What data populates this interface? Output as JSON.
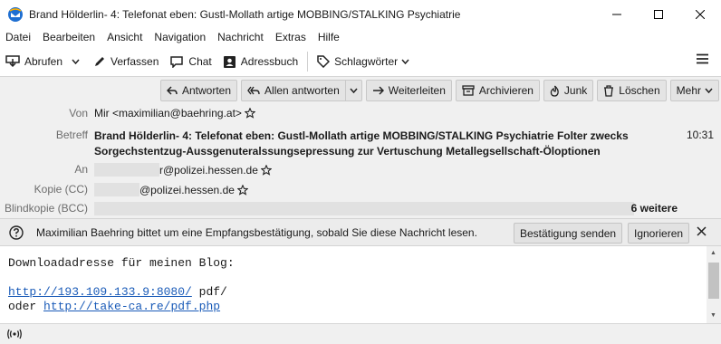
{
  "window": {
    "title": "Brand Hölderlin- 4: Telefonat eben: Gustl-Mollath artige MOBBING/STALKING Psychiatrie Folter zwecks Sorgechstentz..."
  },
  "menu": [
    "Datei",
    "Bearbeiten",
    "Ansicht",
    "Navigation",
    "Nachricht",
    "Extras",
    "Hilfe"
  ],
  "toolbar": {
    "get_messages": "Abrufen",
    "compose": "Verfassen",
    "chat": "Chat",
    "address_book": "Adressbuch",
    "tags": "Schlagwörter"
  },
  "actions": {
    "reply": "Antworten",
    "reply_all": "Allen antworten",
    "forward": "Weiterleiten",
    "archive": "Archivieren",
    "junk": "Junk",
    "delete": "Löschen",
    "more": "Mehr"
  },
  "headers": {
    "from_label": "Von",
    "from_value": "Mir <maximilian@baehring.at>",
    "subject_label": "Betreff",
    "subject_value": "Brand Hölderlin- 4: Telefonat eben: Gustl-Mollath artige MOBBING/STALKING Psychiatrie Folter zwecks Sorgechstentzug-Aussgenuteralssungsepressung zur Vertuschung Metallegsellschaft-Öloptionen",
    "time": "10:31",
    "to_label": "An",
    "to_value": "r@polizei.hessen.de",
    "cc_label": "Kopie (CC)",
    "cc_value": "@polizei.hessen.de",
    "bcc_label": "Blindkopie (BCC)",
    "bcc_more": "6 weitere"
  },
  "notification": {
    "text": "Maximilian Baehring bittet um eine Empfangsbestätigung, sobald Sie diese Nachricht lesen.",
    "send_label": "Bestätigung senden",
    "ignore_label": "Ignorieren"
  },
  "body": {
    "line1": "Downloadadresse für meinen Blog:",
    "link1": "http://193.109.133.9:8080/",
    "after_link1": " pdf/",
    "oder": "oder ",
    "link2": "http://take-ca.re/pdf.php"
  },
  "colors": {
    "accent": "#1a5bb8",
    "header_bg": "#f0f0f0"
  }
}
